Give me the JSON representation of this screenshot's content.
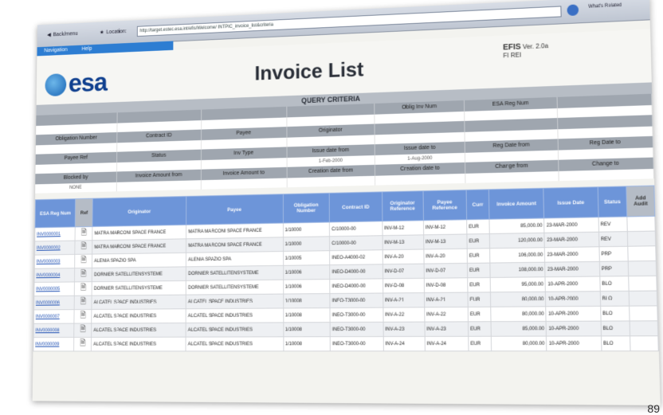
{
  "browser": {
    "back_label": "Back/menu",
    "location_label": "Location:",
    "address": "http://target.estec.esa.int/efis/Welcome/ INTPIC_invoice_list&criteria",
    "links_label": "What's Related"
  },
  "menu": {
    "items": [
      "Navigation",
      "Help"
    ]
  },
  "header": {
    "logo_text": "esa",
    "title": "Invoice List",
    "system_name": "EFIS",
    "version": "Ver. 2.0a",
    "user_id": "FI REI"
  },
  "query": {
    "heading": "QUERY CRITERIA",
    "rows": [
      {
        "labels": [
          "",
          "",
          "",
          "",
          "Oblig Inv Num",
          "ESA Reg Num",
          ""
        ],
        "values": [
          "",
          "",
          "",
          "",
          "",
          "",
          ""
        ]
      },
      {
        "labels": [
          "Obligation Number",
          "Contract ID",
          "Payee",
          "Originator",
          "",
          "",
          ""
        ],
        "values": [
          "",
          "",
          "",
          "",
          "",
          "",
          ""
        ]
      },
      {
        "labels": [
          "Payee Ref",
          "Status",
          "Inv Type",
          "Issue date from",
          "Issue date to",
          "Reg Date from",
          "Reg Date to"
        ],
        "values": [
          "",
          "",
          "",
          "1-Feb-2000",
          "1-Aug-2000",
          "",
          ""
        ]
      },
      {
        "labels": [
          "Blocked by",
          "Invoice Amount from",
          "Invoice Amount to",
          "Creation date from",
          "Creation date to",
          "Change from",
          "Change to"
        ],
        "values": [
          "NONE",
          "",
          "",
          "",
          "",
          "",
          ""
        ]
      }
    ]
  },
  "table": {
    "headers": [
      "ESA Reg Num",
      "Ref",
      "Originator",
      "Payee",
      "Obligation Number",
      "Contract ID",
      "Originator Reference",
      "Payee Reference",
      "Curr",
      "Invoice Amount",
      "Issue Date",
      "Status",
      "Add Audit"
    ],
    "rows": [
      [
        "INV0000001",
        "",
        "MATRA MARCONI SPACE FRANCE",
        "MATRA MARCONI SPACE FRANCE",
        "1/10000",
        "C/10000-00",
        "INV-M-12",
        "INV-M-12",
        "EUR",
        "85,000.00",
        "23-MAR-2000",
        "REV",
        ""
      ],
      [
        "INV0000002",
        "",
        "MATRA MARCONI SPACE FRANCE",
        "MATRA MARCONI SPACE FRANCE",
        "1/10000",
        "C/10000-00",
        "INV-M-13",
        "INV-M-13",
        "EUR",
        "120,000.00",
        "23-MAR-2000",
        "REV",
        ""
      ],
      [
        "INV0000003",
        "",
        "ALENIA SPAZIO SPA",
        "ALENIA SPAZIO SPA",
        "1/10005",
        "INEO-A4000-02",
        "INV-A-20",
        "INV-A-20",
        "EUR",
        "106,000.00",
        "23-MAR-2000",
        "PRP",
        ""
      ],
      [
        "INV0000004",
        "",
        "DORNIER SATELLITENSYSTEME",
        "DORNIER SATELLITENSYSTEME",
        "1/10006",
        "INEO-D4000-00",
        "INV-D-07",
        "INV-D-07",
        "EUR",
        "108,000.00",
        "23-MAR-2000",
        "PRP",
        ""
      ],
      [
        "INV0000005",
        "",
        "DORNIER SATELLITENSYSTEME",
        "DORNIER SATELLITENSYSTEME",
        "1/10006",
        "INEO-D4000-00",
        "INV-D-08",
        "INV-D-08",
        "EUR",
        "95,000.00",
        "10-APR-2000",
        "BLO",
        ""
      ],
      [
        "INV0000006",
        "",
        "ALCATEL SPACE INDUSTRIES",
        "ALCATEL SPACE INDUSTRIES",
        "1/10008",
        "INEO-T3000-00",
        "INV-A-21",
        "INV-A-21",
        "EUR",
        "80,000.00",
        "10-APR-2000",
        "BLO",
        ""
      ],
      [
        "INV0000007",
        "",
        "ALCATEL SPACE INDUSTRIES",
        "ALCATEL SPACE INDUSTRIES",
        "1/10008",
        "INEO-T3000-00",
        "INV-A-22",
        "INV-A-22",
        "EUR",
        "80,000.00",
        "10-APR-2000",
        "BLO",
        ""
      ],
      [
        "INV0000008",
        "",
        "ALCATEL SPACE INDUSTRIES",
        "ALCATEL SPACE INDUSTRIES",
        "1/10008",
        "INEO-T3000-00",
        "INV-A-23",
        "INV-A-23",
        "EUR",
        "85,000.00",
        "10-APR-2000",
        "BLO",
        ""
      ],
      [
        "INV0000009",
        "",
        "ALCATEL SPACE INDUSTRIES",
        "ALCATEL SPACE INDUSTRIES",
        "1/10008",
        "INEO-T3000-00",
        "INV-A-24",
        "INV-A-24",
        "EUR",
        "80,000.00",
        "10-APR-2000",
        "BLO",
        ""
      ]
    ]
  },
  "page_number": "89"
}
